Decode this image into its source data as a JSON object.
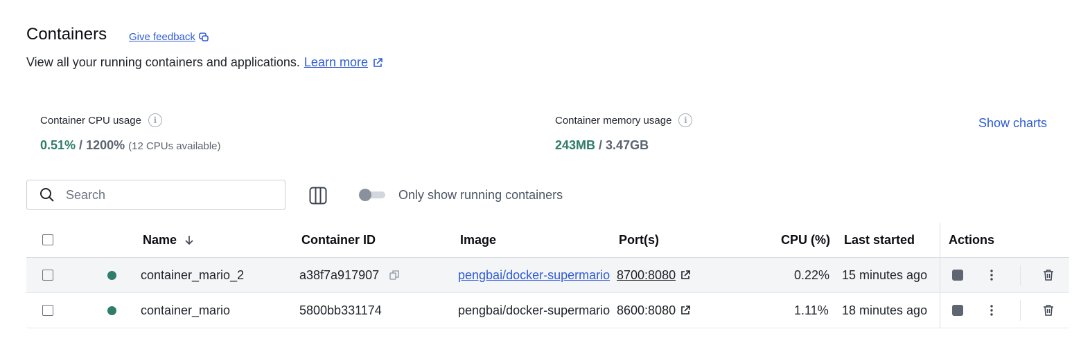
{
  "page": {
    "title": "Containers",
    "feedback_label": "Give feedback",
    "subtitle": "View all your running containers and applications.",
    "learn_more": "Learn more"
  },
  "stats": {
    "cpu": {
      "label": "Container CPU usage",
      "value": "0.51%",
      "separator": "/",
      "total": "1200%",
      "note": "(12 CPUs available)"
    },
    "memory": {
      "label": "Container memory usage",
      "value": "243MB",
      "separator": "/",
      "total": "3.47GB"
    },
    "show_charts": "Show charts"
  },
  "toolbar": {
    "search_placeholder": "Search",
    "toggle_label": "Only show running containers",
    "toggle_on": false
  },
  "table": {
    "headers": {
      "name": "Name",
      "container_id": "Container ID",
      "image": "Image",
      "ports": "Port(s)",
      "cpu": "CPU (%)",
      "last_started": "Last started",
      "actions": "Actions"
    },
    "rows": [
      {
        "name": "container_mario_2",
        "id": "a38f7a917907",
        "image": "pengbai/docker-supermario",
        "port": "8700:8080",
        "cpu": "0.22%",
        "last_started": "15 minutes ago",
        "status": "running"
      },
      {
        "name": "container_mario",
        "id": "5800bb331174",
        "image": "pengbai/docker-supermario",
        "port": "8600:8080",
        "cpu": "1.11%",
        "last_started": "18 minutes ago",
        "status": "running"
      }
    ]
  },
  "colors": {
    "accent_link": "#2e5bd6",
    "running_status": "#2f7d6a"
  },
  "icons": {
    "feedback": "feedback-icon",
    "external_link": "external-link-icon",
    "info": "info-icon",
    "search": "search-icon",
    "columns": "columns-icon",
    "sort": "arrow-down-icon",
    "copy": "copy-icon",
    "stop": "stop-icon",
    "more": "more-vertical-icon",
    "delete": "trash-icon"
  }
}
